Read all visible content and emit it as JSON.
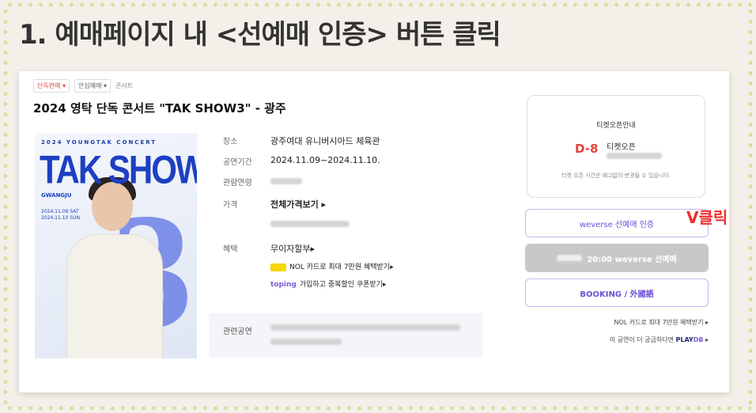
{
  "heading": "1. 예매페이지 내 <선예매 인증> 버튼 클릭",
  "annotation": "V클릭",
  "breadcrumb": {
    "pill1": "단독판매 ▾",
    "pill2": "안심예매 ▾",
    "category": "콘서트"
  },
  "title": "2024 영탁 단독 콘서트 \"TAK SHOW3\" - 광주",
  "poster": {
    "concert_text": "2024 YOUNGTAK CONCERT",
    "big_text": "TAK SHOW",
    "city": "GWANGJU",
    "date1": "2024.11.09 SAT",
    "date2": "2024.11.10 SUN",
    "numeral": "3"
  },
  "info": {
    "venue_label": "장소",
    "venue_value": "광주여대 유니버시아드 체육관",
    "period_label": "공연기간",
    "period_value": "2024.11.09~2024.11.10.",
    "age_label": "관람연령",
    "price_label": "가격",
    "price_value": "전체가격보기 ▸",
    "benefit_label": "혜택",
    "benefit_value": "무이자할부▸",
    "nol_text": "NOL 카드로 최대 7만원 혜택받기▸",
    "toping_brand": "toping",
    "toping_text": "가입하고 중복할인 쿠폰받기▸",
    "related_label": "관련공연"
  },
  "ticket_open": {
    "header": "티켓오픈안내",
    "dday": "D-8",
    "open_label": "티켓오픈",
    "notice": "티켓 오픈 시간은 예고없이 변경될 수 있습니다."
  },
  "buttons": {
    "cert": "weverse 선예매 인증",
    "presale": "20:00 weverse 선예매",
    "booking": "BOOKING / 外國語"
  },
  "links": {
    "nol": "NOL 카드로 최대 7만원 혜택받기 ▸",
    "playdb_prefix": "이 공연이 더 궁금하다면",
    "playdb_brand": "PLAY",
    "playdb_brand2": "DB",
    "playdb_arrow": "▸"
  },
  "colors": {
    "accent": "#6b4fd8",
    "alert": "#ee2d2d",
    "dday": "#e4413a"
  }
}
